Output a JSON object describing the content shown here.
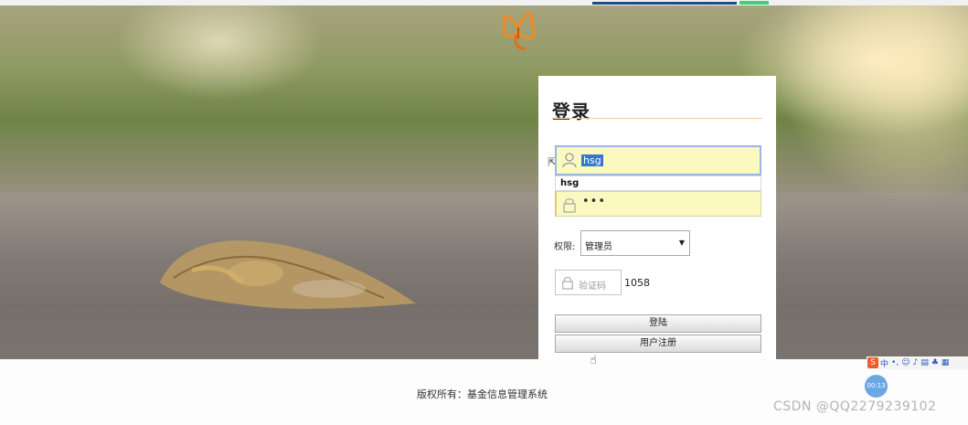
{
  "login": {
    "title": "登录",
    "username_value": "hsg",
    "autocomplete_suggestion": "hsg",
    "password_masked": "•••",
    "role_label": "权限:",
    "role_selected": "管理员",
    "captcha_placeholder": "验证码",
    "captcha_code": "1058",
    "login_button": "登陆",
    "register_button": "用户注册"
  },
  "footer": {
    "copyright": "版权所有：基金信息管理系统"
  },
  "ime": {
    "logo": "S",
    "lang": "中"
  },
  "recorder": {
    "timer": "00:13"
  },
  "watermark": {
    "text": "CSDN @QQ2279239102"
  },
  "colors": {
    "field_fill": "#fbf8c0",
    "selection": "#3578d0",
    "title_underline": "#f0cfa0"
  },
  "icons": [
    "user-icon",
    "lock-icon",
    "butterfly-logo-icon",
    "dropdown-arrow-icon",
    "hand-cursor-icon",
    "arrow-cursor-icon"
  ]
}
